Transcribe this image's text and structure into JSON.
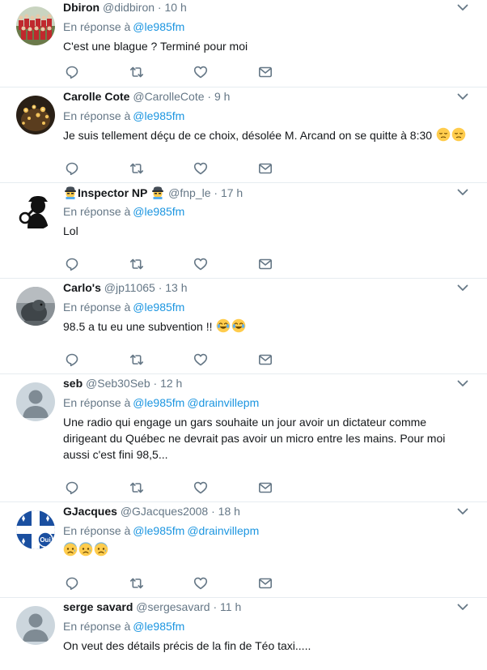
{
  "reply_prefix": "En réponse à",
  "colors": {
    "link": "#1b95e0",
    "muted": "#657786",
    "divider": "#e6ecf0"
  },
  "tweets": [
    {
      "name": "Dbiron",
      "handle": "@didbiron",
      "sep": "·",
      "time": "10 h",
      "mentions": [
        "@le985fm"
      ],
      "text": "C'est une blague ? Terminé pour moi",
      "emoji": []
    },
    {
      "name": "Carolle Cote",
      "handle": "@CarolleCote",
      "sep": "·",
      "time": "9 h",
      "mentions": [
        "@le985fm"
      ],
      "text": "Je suis tellement déçu de ce choix, désolée M. Arcand on se quitte à 8:30",
      "emoji": [
        "pensive-face-icon",
        "pensive-face-icon"
      ]
    },
    {
      "name": "Inspector NP",
      "handle": "@fnp_le",
      "sep": "·",
      "time": "17 h",
      "mentions": [
        "@le985fm"
      ],
      "text": "Lol",
      "emoji": []
    },
    {
      "name": "Carlo's",
      "handle": "@jp11065",
      "sep": "·",
      "time": "13 h",
      "mentions": [
        "@le985fm"
      ],
      "text": "98.5 a tu eu une subvention !!",
      "emoji": [
        "joy-face-icon",
        "joy-face-icon"
      ]
    },
    {
      "name": "seb",
      "handle": "@Seb30Seb",
      "sep": "·",
      "time": "12 h",
      "mentions": [
        "@le985fm",
        "@drainvillepm"
      ],
      "text": "Une radio qui engage un gars souhaite un jour avoir un dictateur comme dirigeant du Québec ne devrait pas avoir un micro entre les mains. Pour moi aussi c'est fini 98,5...",
      "emoji": []
    },
    {
      "name": "GJacques",
      "handle": "@GJacques2008",
      "sep": "·",
      "time": "18 h",
      "mentions": [
        "@le985fm",
        "@drainvillepm"
      ],
      "text": "",
      "emoji": [
        "anxious-face-icon",
        "anxious-face-icon",
        "anxious-face-icon"
      ],
      "avatar_badge": "Oui"
    },
    {
      "name": "serge savard",
      "handle": "@sergesavard",
      "sep": "·",
      "time": "11 h",
      "mentions": [
        "@le985fm"
      ],
      "text": "On veut des détails précis de la fin de Téo taxi.....",
      "emoji": []
    }
  ]
}
